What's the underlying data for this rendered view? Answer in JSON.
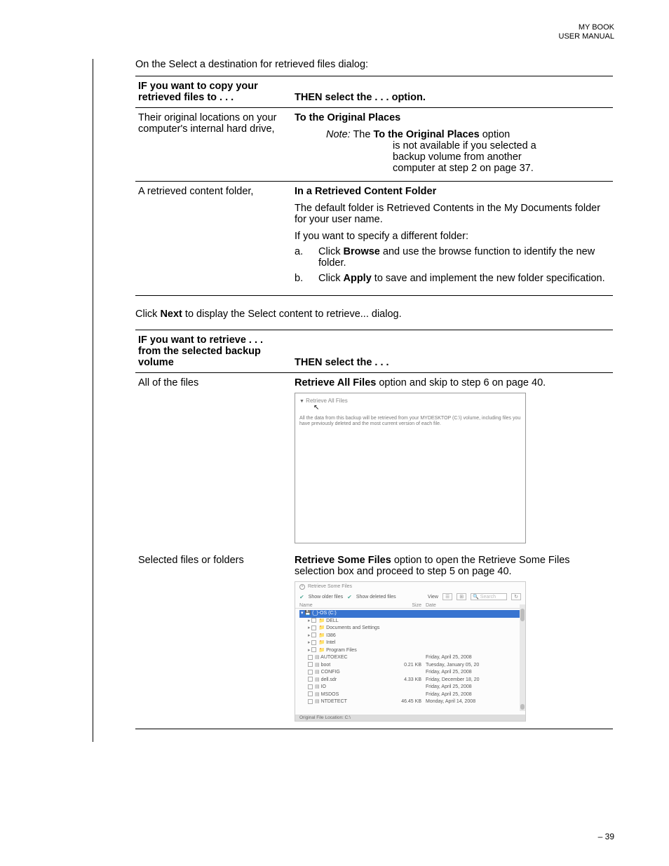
{
  "header": {
    "line1": "MY BOOK",
    "line2": "USER MANUAL"
  },
  "intro": "On the Select a destination for retrieved files dialog:",
  "table1": {
    "head_left_1": "IF you want to copy your",
    "head_left_2": "retrieved files to . . .",
    "head_right": "THEN select the . . . option.",
    "row1": {
      "left": "Their original locations on your computer's internal hard drive,",
      "right_title": "To the Original Places",
      "note_label": "Note:",
      "note_pre": " The ",
      "note_bold": "To the Original Places",
      "note_post1": " option",
      "note_line2": "is not available if you selected a",
      "note_line3": "backup volume from another",
      "note_line4": "computer at step 2 on page 37."
    },
    "row2": {
      "left": "A retrieved content folder,",
      "right_title": "In a Retrieved Content Folder",
      "p1": "The default folder is Retrieved Contents in the My Documents folder for your user name.",
      "p2": "If you want to specify a different folder:",
      "a_marker": "a.",
      "a_pre": "Click ",
      "a_bold": "Browse",
      "a_post": " and use the browse function to identify the new folder.",
      "b_marker": "b.",
      "b_pre": "Click ",
      "b_bold": "Apply",
      "b_post": " to save and implement the new folder specification."
    }
  },
  "mid": {
    "pre": "Click ",
    "bold": "Next",
    "post": " to display the Select content to retrieve... dialog."
  },
  "table2": {
    "head_left_1": "IF you want to retrieve . . .",
    "head_left_2": "from the selected backup",
    "head_left_3": "volume",
    "head_right": "THEN select the . . .",
    "row1": {
      "left": "All of the files",
      "right_bold": "Retrieve All Files",
      "right_post": " option and skip to step 6 on page 40.",
      "mock_title": "Retrieve All Files",
      "mock_desc": "All the data from this backup will be retrieved from your MYDESKTOP (C:\\) volume, including files you have previously deleted and the most current version of each file."
    },
    "row2": {
      "left": "Selected files or folders",
      "right_bold": "Retrieve Some Files",
      "right_post": " option to open the Retrieve Some Files selection box and proceed to step 5 on page 40.",
      "mock": {
        "title": "Retrieve Some Files",
        "show_older": "Show older files",
        "show_deleted": "Show deleted files",
        "view_label": "View",
        "search_placeholder": "Search",
        "col_name": "Name",
        "col_size": "Size",
        "col_date": "Date",
        "rows": [
          {
            "name": "(_)-OS (C:)",
            "size": "",
            "date": "",
            "selected": true
          },
          {
            "name": "DELL",
            "size": "",
            "date": "",
            "folder": true,
            "expand": true
          },
          {
            "name": "Documents and Settings",
            "size": "",
            "date": "",
            "folder": true,
            "expand": true
          },
          {
            "name": "I386",
            "size": "",
            "date": "",
            "folder": true,
            "expand": true
          },
          {
            "name": "Intel",
            "size": "",
            "date": "",
            "folder": true,
            "expand": true
          },
          {
            "name": "Program Files",
            "size": "",
            "date": "",
            "folder": true,
            "expand": true
          },
          {
            "name": "AUTOEXEC",
            "size": "",
            "date": "Friday, April 25, 2008",
            "file": true
          },
          {
            "name": "boot",
            "size": "0.21 KB",
            "date": "Tuesday, January 05, 20",
            "file": true
          },
          {
            "name": "CONFIG",
            "size": "",
            "date": "Friday, April 25, 2008",
            "file": true
          },
          {
            "name": "dell.sdr",
            "size": "4.33 KB",
            "date": "Friday, December 18, 20",
            "file": true
          },
          {
            "name": "IO",
            "size": "",
            "date": "Friday, April 25, 2008",
            "file": true
          },
          {
            "name": "MSDOS",
            "size": "",
            "date": "Friday, April 25, 2008",
            "file": true
          },
          {
            "name": "NTDETECT",
            "size": "46.45 KB",
            "date": "Monday, April 14, 2008",
            "file": true
          }
        ],
        "bottom": "Original File Location:   C:\\"
      }
    }
  },
  "footer": "– 39"
}
